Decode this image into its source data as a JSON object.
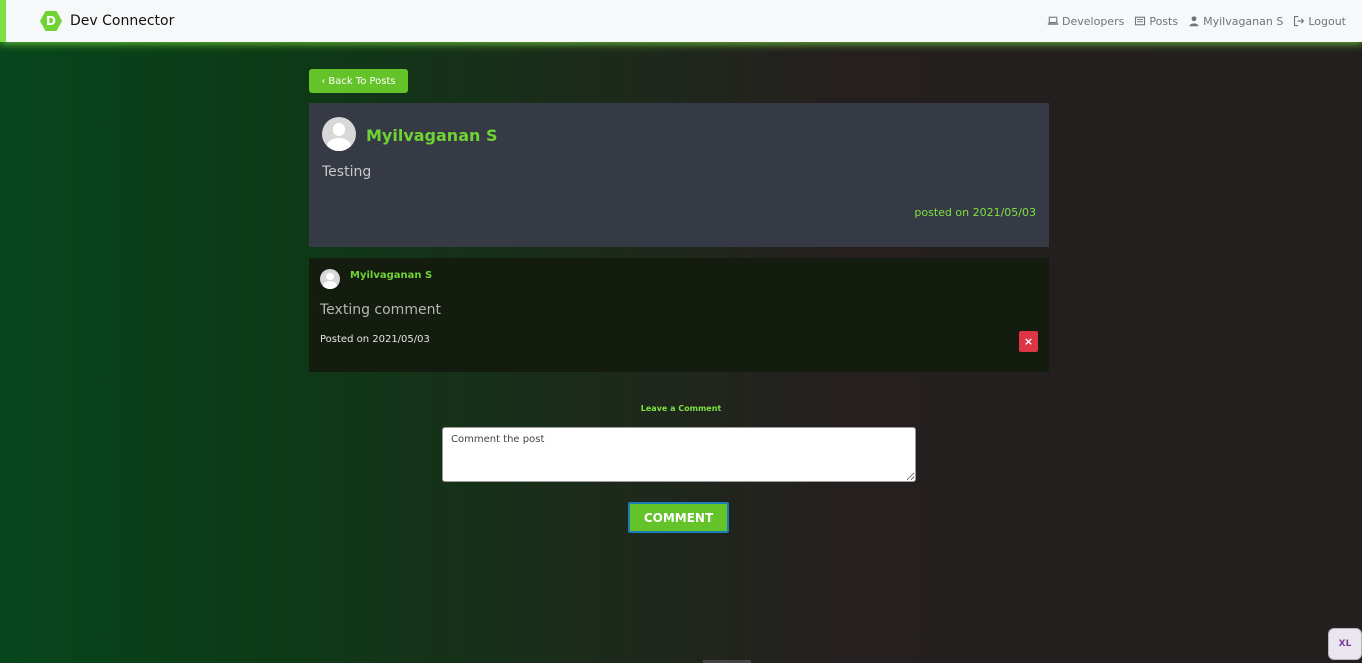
{
  "navbar": {
    "brand": "Dev Connector",
    "logo_letter": "D",
    "links": [
      {
        "label": "Developers",
        "icon": "laptop-icon"
      },
      {
        "label": "Posts",
        "icon": "posts-icon"
      },
      {
        "label": "Myilvaganan S",
        "icon": "user-icon"
      },
      {
        "label": "Logout",
        "icon": "logout-icon"
      }
    ]
  },
  "back_button": {
    "label": "Back To Posts",
    "icon": "chevron-left-icon"
  },
  "post": {
    "author": "Myilvaganan S",
    "text": "Testing",
    "date": "posted on 2021/05/03"
  },
  "comments": [
    {
      "author": "Myilvaganan S",
      "text": "Texting comment",
      "date": "Posted on 2021/05/03",
      "delete_label": "×"
    }
  ],
  "comment_form": {
    "heading": "Leave a Comment",
    "placeholder": "Comment the post",
    "submit_label": "COMMENT"
  },
  "badge": {
    "label": "XL"
  },
  "colors": {
    "accent": "#6fd334",
    "button": "#63c328",
    "danger": "#dc3545",
    "post_bg": "#363a45",
    "comment_bg": "#141c10"
  }
}
